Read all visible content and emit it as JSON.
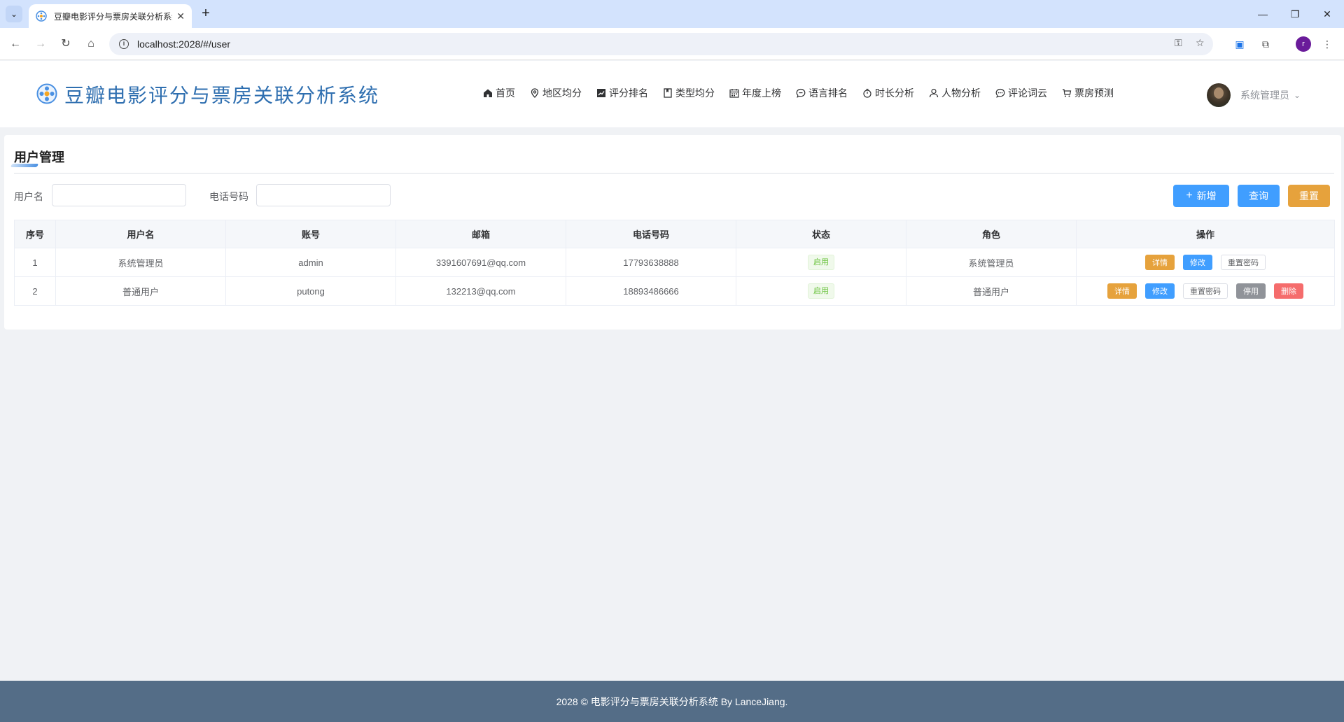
{
  "browser": {
    "tab_title": "豆瓣电影评分与票房关联分析系统",
    "url": "localhost:2028/#/user",
    "profile_initial": "r"
  },
  "header": {
    "app_title": "豆瓣电影评分与票房关联分析系统",
    "nav": [
      {
        "label": "首页",
        "icon": "home-icon"
      },
      {
        "label": "地区均分",
        "icon": "location-icon"
      },
      {
        "label": "评分排名",
        "icon": "trend-chart-icon"
      },
      {
        "label": "类型均分",
        "icon": "notebook-icon"
      },
      {
        "label": "年度上榜",
        "icon": "calendar-icon"
      },
      {
        "label": "语言排名",
        "icon": "chat-icon"
      },
      {
        "label": "时长分析",
        "icon": "stopwatch-icon"
      },
      {
        "label": "人物分析",
        "icon": "user-icon"
      },
      {
        "label": "评论词云",
        "icon": "chat-dots-icon"
      },
      {
        "label": "票房预测",
        "icon": "shopping-cart-icon"
      }
    ],
    "user_name": "系统管理员"
  },
  "page": {
    "title": "用户管理",
    "filters": {
      "username_label": "用户名",
      "username_value": "",
      "phone_label": "电话号码",
      "phone_value": ""
    },
    "buttons": {
      "add": "新增",
      "query": "查询",
      "reset": "重置"
    },
    "table": {
      "columns": [
        "序号",
        "用户名",
        "账号",
        "邮箱",
        "电话号码",
        "状态",
        "角色",
        "操作"
      ],
      "rows": [
        {
          "index": "1",
          "username": "系统管理员",
          "account": "admin",
          "email": "3391607691@qq.com",
          "phone": "17793638888",
          "status": "启用",
          "role": "系统管理员"
        },
        {
          "index": "2",
          "username": "普通用户",
          "account": "putong",
          "email": "132213@qq.com",
          "phone": "18893486666",
          "status": "启用",
          "role": "普通用户"
        }
      ],
      "actions": {
        "detail": "详情",
        "edit": "修改",
        "reset_password": "重置密码",
        "disable": "停用",
        "delete": "删除"
      }
    }
  },
  "footer": {
    "text": "2028 © 电影评分与票房关联分析系统 By LanceJiang."
  },
  "colors": {
    "primary": "#409eff",
    "warning": "#e6a23c",
    "danger": "#f56c6c",
    "info": "#909399",
    "success": "#67c23a",
    "footer_bg": "#546d87",
    "logo_text": "#2f6fb0"
  }
}
